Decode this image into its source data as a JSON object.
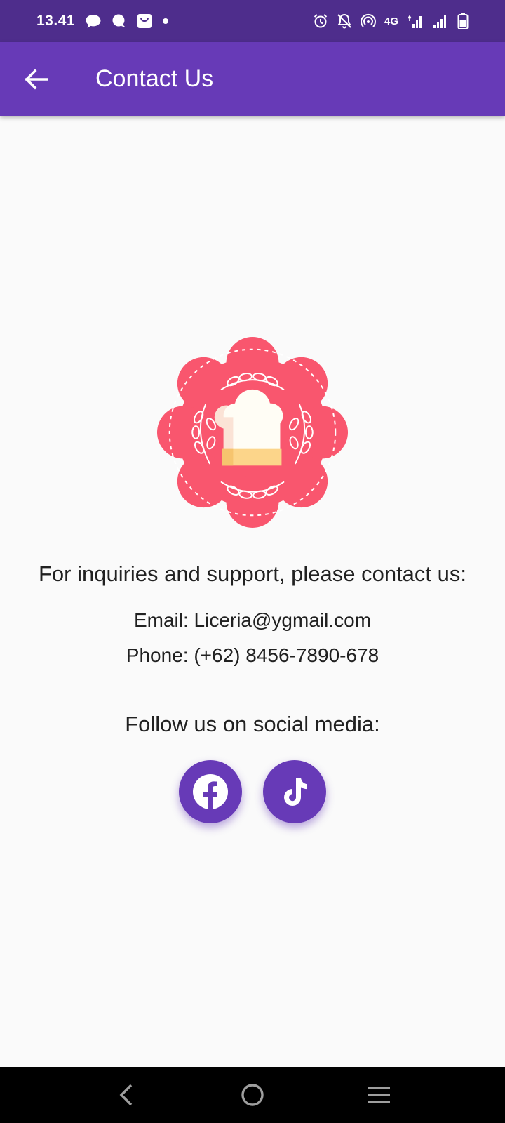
{
  "status_bar": {
    "time": "13.41",
    "network_label": "4G"
  },
  "app_bar": {
    "title": "Contact Us"
  },
  "contact": {
    "inquiry_text": "For inquiries and support, please contact us:",
    "email": "Email: Liceria@ygmail.com",
    "phone": "Phone: (+62) 8456-7890-678",
    "follow_text": "Follow us on social media:"
  },
  "social_links": [
    {
      "name": "facebook",
      "icon": "facebook-icon"
    },
    {
      "name": "tiktok",
      "icon": "tiktok-icon"
    }
  ],
  "colors": {
    "status_bar": "#4e2d8c",
    "app_bar": "#673ab7",
    "accent": "#673ab7",
    "background": "#fafafa",
    "logo_badge": "#f9566e",
    "chef_hat": "#fffdf5",
    "hat_band": "#fcd58a",
    "nav_bar": "#000000"
  }
}
